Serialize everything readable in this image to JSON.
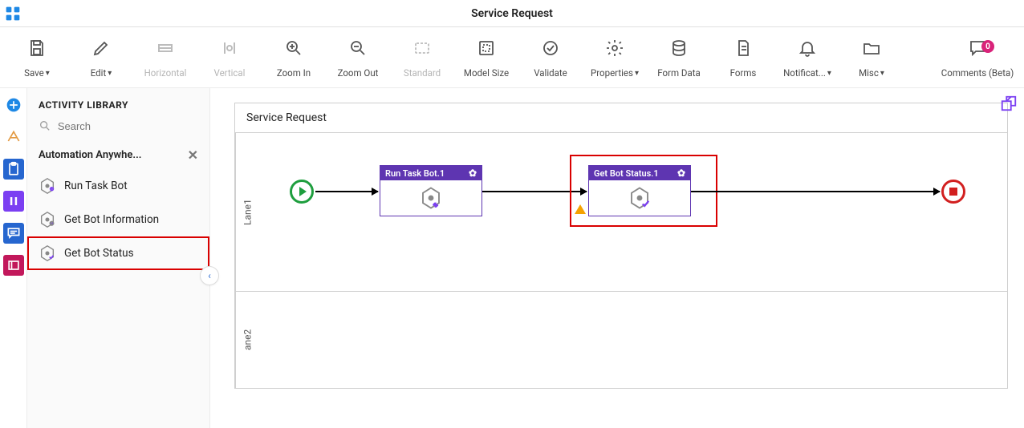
{
  "header": {
    "title": "Service Request"
  },
  "toolbar": {
    "save": "Save",
    "edit": "Edit",
    "horizontal": "Horizontal",
    "vertical": "Vertical",
    "zoom_in": "Zoom In",
    "zoom_out": "Zoom Out",
    "standard": "Standard",
    "model_size": "Model Size",
    "validate": "Validate",
    "properties": "Properties",
    "form_data": "Form Data",
    "forms": "Forms",
    "notifications": "Notificat...",
    "misc": "Misc",
    "comments": "Comments (Beta)",
    "comment_count": "0"
  },
  "library": {
    "heading": "ACTIVITY LIBRARY",
    "search_placeholder": "Search",
    "group_name": "Automation Anywhe...",
    "items": [
      {
        "label": "Run Task Bot"
      },
      {
        "label": "Get Bot Information"
      },
      {
        "label": "Get Bot Status"
      }
    ]
  },
  "process": {
    "title": "Service Request",
    "lanes": [
      "Lane1",
      "ane2"
    ],
    "nodes": [
      {
        "title": "Run Task Bot.1",
        "has_warning": false
      },
      {
        "title": "Get Bot Status.1",
        "has_warning": true
      }
    ]
  }
}
